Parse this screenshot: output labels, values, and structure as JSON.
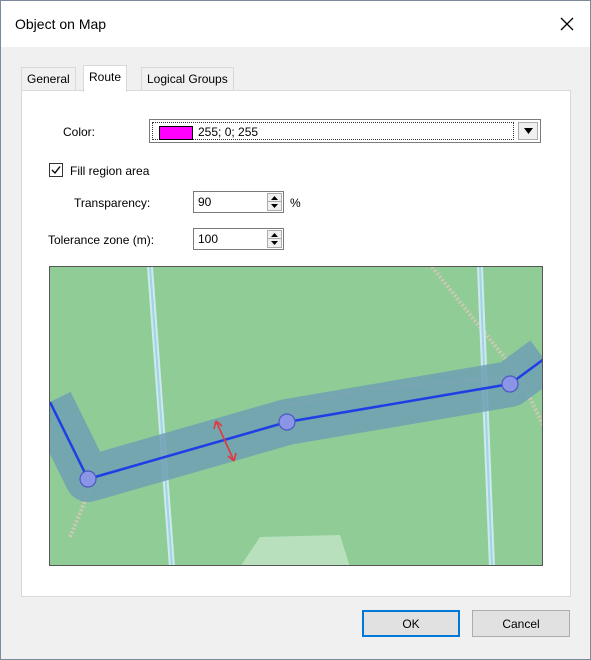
{
  "window": {
    "title": "Object on Map"
  },
  "tabs": [
    {
      "label": "General",
      "active": false
    },
    {
      "label": "Route",
      "active": true
    },
    {
      "label": "Logical Groups",
      "active": false
    }
  ],
  "form": {
    "color_label": "Color:",
    "color_value": "255; 0; 255",
    "color_swatch": "#ff00ff",
    "fill_label": "Fill region area",
    "fill_checked": true,
    "transparency_label": "Transparency:",
    "transparency_value": "90",
    "transparency_unit": "%",
    "tolerance_label": "Tolerance zone (m):",
    "tolerance_value": "100"
  },
  "buttons": {
    "ok": "OK",
    "cancel": "Cancel"
  },
  "colors": {
    "map_green": "#8fcc96",
    "route_line": "#1f3fe6",
    "route_band": "#6f9fb4",
    "waypoint": "#8a95e6",
    "arrow": "#e23a3a"
  },
  "icons": {
    "close": "close-icon",
    "dropdown": "chevron-down-icon",
    "checkbox": "check-icon",
    "spin_up": "arrow-up-icon",
    "spin_down": "arrow-down-icon",
    "tolerance_arrow": "double-arrow-icon"
  }
}
